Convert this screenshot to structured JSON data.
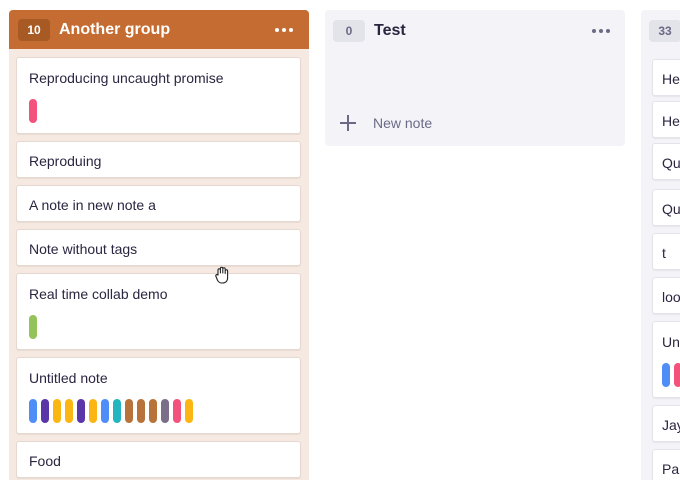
{
  "columns": [
    {
      "count": "10",
      "title": "Another group",
      "color": "#c46c31",
      "cards": [
        {
          "title": "Reproducing uncaught promise",
          "tags": [
            "#f2527c"
          ]
        },
        {
          "title": "Reproduing",
          "tags": []
        },
        {
          "title": "A note in new note a",
          "tags": []
        },
        {
          "title": "Note without tags",
          "tags": []
        },
        {
          "title": "Real time collab demo",
          "tags": [
            "#94c35a"
          ]
        },
        {
          "title": "Untitled note",
          "tags": [
            "#4f8ef7",
            "#5a36a8",
            "#fbb613",
            "#fbb613",
            "#5a36a8",
            "#fbb613",
            "#4f8ef7",
            "#23b6c0",
            "#b8733a",
            "#b8733a",
            "#b8733a",
            "#7a6e8a",
            "#f2527c",
            "#fbb613"
          ]
        },
        {
          "title": "Food",
          "tags": []
        }
      ]
    },
    {
      "count": "0",
      "title": "Test",
      "new_note_label": "New note"
    },
    {
      "count": "33",
      "cards": [
        {
          "title": "He"
        },
        {
          "title": "He"
        },
        {
          "title": "Qu"
        },
        {
          "title": "Qu"
        },
        {
          "title": "t"
        },
        {
          "title": "loo"
        },
        {
          "title": "Un",
          "tags": [
            "#4f8ef7",
            "#f2527c"
          ]
        },
        {
          "title": "Jay"
        },
        {
          "title": "Pau"
        }
      ]
    }
  ]
}
